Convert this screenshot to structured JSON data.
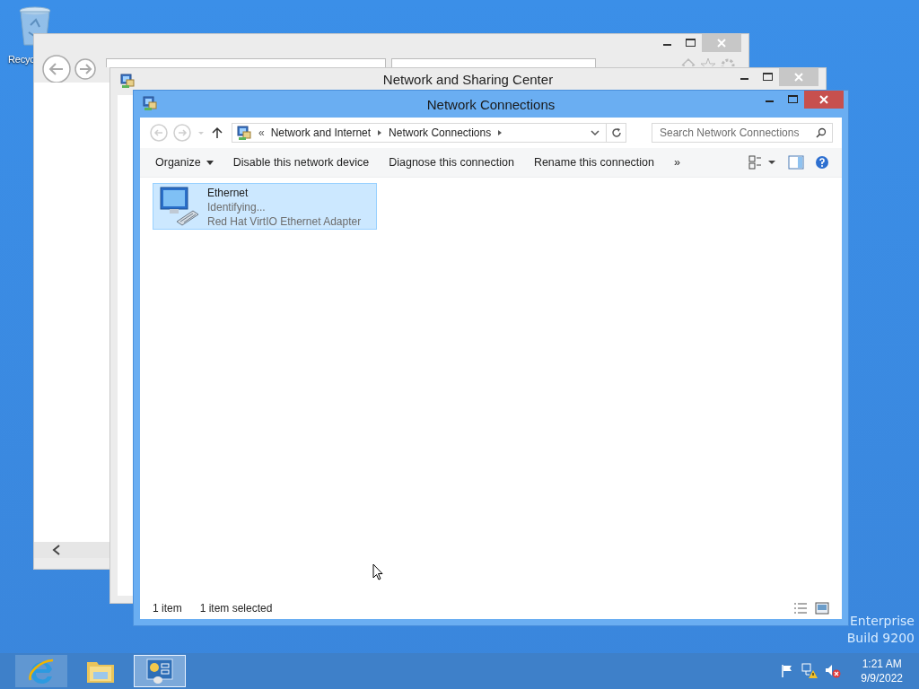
{
  "desktop": {
    "icons": [
      {
        "label": "Recyc"
      }
    ],
    "edition": [
      "Enterprise",
      "Build 9200"
    ]
  },
  "background_window": {
    "title": "Network and Sharing Center"
  },
  "window": {
    "title": "Network Connections",
    "address": {
      "prefix": "«",
      "crumbs": [
        "Network and Internet",
        "Network Connections"
      ]
    },
    "search": {
      "placeholder": "Search Network Connections"
    },
    "toolbar": {
      "organize": "Organize",
      "commands": [
        "Disable this network device",
        "Diagnose this connection",
        "Rename this connection"
      ],
      "more": "»"
    },
    "items": [
      {
        "name": "Ethernet",
        "status": "Identifying...",
        "device": "Red Hat VirtIO Ethernet Adapter",
        "selected": true
      }
    ],
    "status_bar": [
      "1 item",
      "1 item selected"
    ]
  },
  "taskbar": {
    "buttons": [
      {
        "kind": "browser",
        "running": true,
        "selected": false
      },
      {
        "kind": "explorer",
        "running": false,
        "selected": false
      },
      {
        "kind": "control-panel",
        "running": true,
        "selected": true
      }
    ],
    "time": "1:21 AM",
    "date": "9/9/2022"
  }
}
